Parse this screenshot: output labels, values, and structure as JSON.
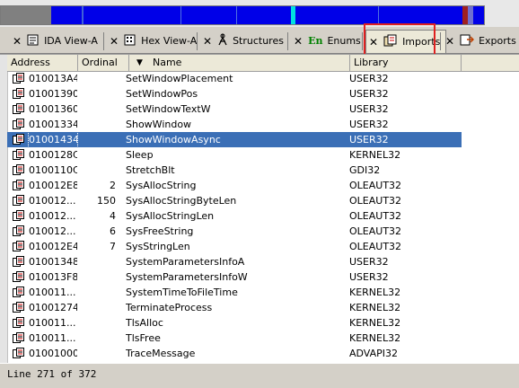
{
  "tabs": [
    {
      "label": "IDA View-A",
      "icon": "ida-view-icon"
    },
    {
      "label": "Hex View-A",
      "icon": "hex-view-icon"
    },
    {
      "label": "Structures",
      "icon": "structures-icon"
    },
    {
      "label": "Enums",
      "icon": "enums-icon",
      "icon_text": "En"
    },
    {
      "label": "Imports",
      "icon": "imports-icon"
    },
    {
      "label": "Exports",
      "icon": "exports-icon"
    }
  ],
  "columns": {
    "address": "Address",
    "ordinal": "Ordinal",
    "name": "Name",
    "library": "Library"
  },
  "rows": [
    {
      "address": "010013A4",
      "ordinal": "",
      "name": "SetWindowPlacement",
      "library": "USER32"
    },
    {
      "address": "01001390",
      "ordinal": "",
      "name": "SetWindowPos",
      "library": "USER32"
    },
    {
      "address": "01001360",
      "ordinal": "",
      "name": "SetWindowTextW",
      "library": "USER32"
    },
    {
      "address": "01001334",
      "ordinal": "",
      "name": "ShowWindow",
      "library": "USER32"
    },
    {
      "address": "01001434",
      "ordinal": "",
      "name": "ShowWindowAsync",
      "library": "USER32"
    },
    {
      "address": "0100128C",
      "ordinal": "",
      "name": "Sleep",
      "library": "KERNEL32"
    },
    {
      "address": "0100110C",
      "ordinal": "",
      "name": "StretchBlt",
      "library": "GDI32"
    },
    {
      "address": "010012E8",
      "ordinal": "2",
      "name": "SysAllocString",
      "library": "OLEAUT32"
    },
    {
      "address": "010012...",
      "ordinal": "150",
      "name": "SysAllocStringByteLen",
      "library": "OLEAUT32"
    },
    {
      "address": "010012...",
      "ordinal": "4",
      "name": "SysAllocStringLen",
      "library": "OLEAUT32"
    },
    {
      "address": "010012...",
      "ordinal": "6",
      "name": "SysFreeString",
      "library": "OLEAUT32"
    },
    {
      "address": "010012E4",
      "ordinal": "7",
      "name": "SysStringLen",
      "library": "OLEAUT32"
    },
    {
      "address": "01001348",
      "ordinal": "",
      "name": "SystemParametersInfoA",
      "library": "USER32"
    },
    {
      "address": "010013F8",
      "ordinal": "",
      "name": "SystemParametersInfoW",
      "library": "USER32"
    },
    {
      "address": "010011...",
      "ordinal": "",
      "name": "SystemTimeToFileTime",
      "library": "KERNEL32"
    },
    {
      "address": "01001274",
      "ordinal": "",
      "name": "TerminateProcess",
      "library": "KERNEL32"
    },
    {
      "address": "010011...",
      "ordinal": "",
      "name": "TlsAlloc",
      "library": "KERNEL32"
    },
    {
      "address": "010011...",
      "ordinal": "",
      "name": "TlsFree",
      "library": "KERNEL32"
    },
    {
      "address": "01001000",
      "ordinal": "",
      "name": "TraceMessage",
      "library": "ADVAPI32"
    }
  ],
  "selected_row_index": 4,
  "status": {
    "text": "Line 271 of 372"
  },
  "colors": {
    "selection": "#3b6fb6",
    "highlight_box": "#e02020",
    "navband_main": "#0000e8"
  }
}
